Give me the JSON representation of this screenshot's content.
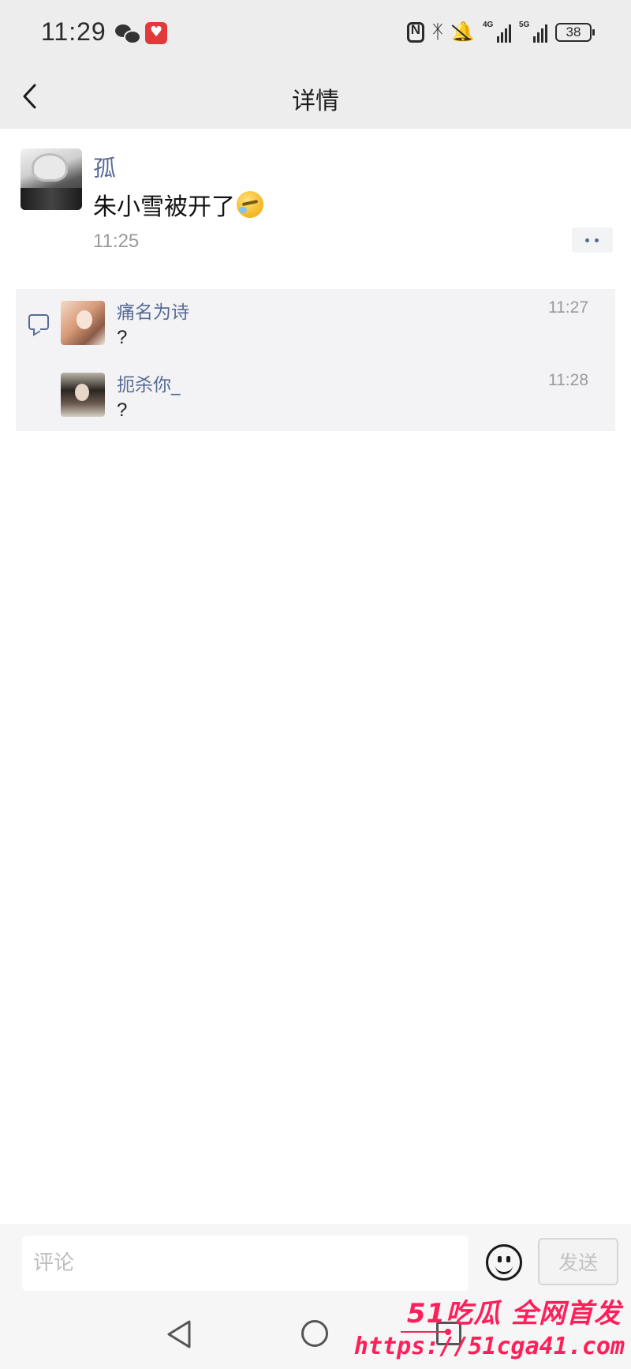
{
  "status_bar": {
    "time": "11:29",
    "network_1": "4G",
    "network_2": "5G",
    "battery": "38"
  },
  "header": {
    "title": "详情"
  },
  "post": {
    "author": "孤",
    "text": "朱小雪被开了",
    "emoji_icon": "crying-face-icon",
    "time": "11:25"
  },
  "comments": [
    {
      "name": "痛名为诗",
      "text": "?",
      "time": "11:27"
    },
    {
      "name": "扼杀你_",
      "text": "?",
      "time": "11:28"
    }
  ],
  "input_bar": {
    "placeholder": "评论",
    "send_label": "发送"
  },
  "watermark": {
    "line1": "51吃瓜 全网首发",
    "line2": "https://51cga41.com"
  },
  "colors": {
    "link_blue": "#576b95",
    "header_bg": "#ededed",
    "watermark": "#ff1f5a"
  }
}
